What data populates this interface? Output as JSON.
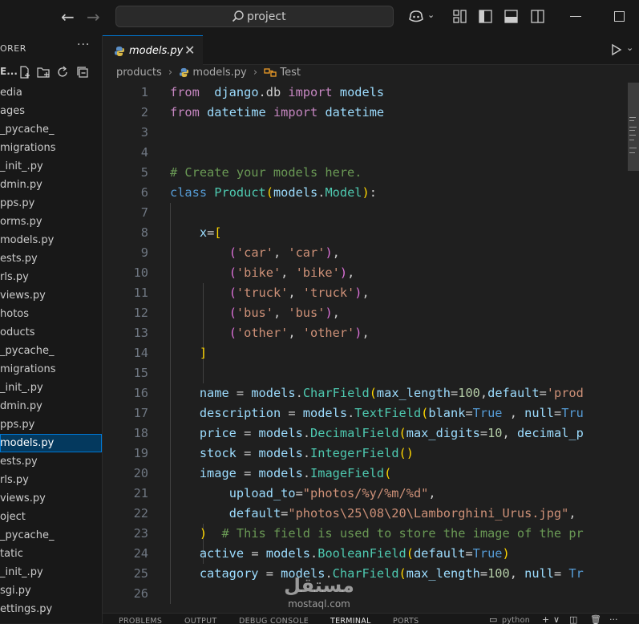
{
  "titlebar": {
    "search_text": "project"
  },
  "sidebar": {
    "title": "ORER",
    "more": "···",
    "project_label": "E...",
    "items": [
      {
        "label": "edia",
        "indent": 0
      },
      {
        "label": "ages",
        "indent": 0
      },
      {
        "label": "_pycache_",
        "indent": 0
      },
      {
        "label": "migrations",
        "indent": 0
      },
      {
        "label": "_init_.py",
        "indent": 0
      },
      {
        "label": "dmin.py",
        "indent": 0
      },
      {
        "label": "pps.py",
        "indent": 0
      },
      {
        "label": "orms.py",
        "indent": 0
      },
      {
        "label": "models.py",
        "indent": 0
      },
      {
        "label": "ests.py",
        "indent": 0
      },
      {
        "label": "rls.py",
        "indent": 0
      },
      {
        "label": "views.py",
        "indent": 0
      },
      {
        "label": "hotos",
        "indent": 0
      },
      {
        "label": "oducts",
        "indent": 0
      },
      {
        "label": "_pycache_",
        "indent": 0
      },
      {
        "label": "migrations",
        "indent": 0
      },
      {
        "label": "_init_.py",
        "indent": 0
      },
      {
        "label": "dmin.py",
        "indent": 0
      },
      {
        "label": "pps.py",
        "indent": 0
      },
      {
        "label": "models.py",
        "indent": 0,
        "active": true
      },
      {
        "label": "ests.py",
        "indent": 0
      },
      {
        "label": "rls.py",
        "indent": 0
      },
      {
        "label": "views.py",
        "indent": 0
      },
      {
        "label": "oject",
        "indent": 0
      },
      {
        "label": "_pycache_",
        "indent": 0
      },
      {
        "label": "tatic",
        "indent": 0
      },
      {
        "label": "_init_.py",
        "indent": 0
      },
      {
        "label": "sgi.py",
        "indent": 0
      },
      {
        "label": "ettings.py",
        "indent": 0
      }
    ]
  },
  "editor": {
    "tab_label": "models.py",
    "tab_close": "✕",
    "breadcrumb": [
      "products",
      "models.py",
      "Test"
    ],
    "lines": [
      {
        "n": "1",
        "tokens": [
          [
            "kw",
            "from"
          ],
          [
            "",
            "  "
          ],
          [
            "va",
            "django"
          ],
          [
            "",
            ".db "
          ],
          [
            "kw",
            "import"
          ],
          [
            "",
            " "
          ],
          [
            "va",
            "models"
          ]
        ]
      },
      {
        "n": "2",
        "tokens": [
          [
            "kw",
            "from"
          ],
          [
            "",
            " "
          ],
          [
            "va",
            "datetime"
          ],
          [
            "",
            " "
          ],
          [
            "kw",
            "import"
          ],
          [
            "",
            " "
          ],
          [
            "va",
            "datetime"
          ]
        ]
      },
      {
        "n": "3",
        "tokens": []
      },
      {
        "n": "4",
        "tokens": []
      },
      {
        "n": "5",
        "tokens": [
          [
            "co",
            "# Create your models here."
          ]
        ]
      },
      {
        "n": "6",
        "tokens": [
          [
            "bk",
            "class"
          ],
          [
            "",
            " "
          ],
          [
            "ty",
            "Product"
          ],
          [
            "b1",
            "("
          ],
          [
            "va",
            "models"
          ],
          [
            "",
            "."
          ],
          [
            "ty",
            "Model"
          ],
          [
            "b1",
            ")"
          ],
          [
            "",
            ":"
          ]
        ]
      },
      {
        "n": "7",
        "tokens": []
      },
      {
        "n": "8",
        "tokens": [
          [
            "",
            "    "
          ],
          [
            "va",
            "x"
          ],
          [
            "",
            "="
          ],
          [
            "b1",
            "["
          ]
        ]
      },
      {
        "n": "9",
        "tokens": [
          [
            "",
            "        "
          ],
          [
            "b2",
            "("
          ],
          [
            "st",
            "'car'"
          ],
          [
            "",
            ", "
          ],
          [
            "st",
            "'car'"
          ],
          [
            "b2",
            ")"
          ],
          [
            "",
            ","
          ]
        ]
      },
      {
        "n": "10",
        "tokens": [
          [
            "",
            "        "
          ],
          [
            "b2",
            "("
          ],
          [
            "st",
            "'bike'"
          ],
          [
            "",
            ", "
          ],
          [
            "st",
            "'bike'"
          ],
          [
            "b2",
            ")"
          ],
          [
            "",
            ","
          ]
        ]
      },
      {
        "n": "11",
        "tokens": [
          [
            "",
            "        "
          ],
          [
            "b2",
            "("
          ],
          [
            "st",
            "'truck'"
          ],
          [
            "",
            ", "
          ],
          [
            "st",
            "'truck'"
          ],
          [
            "b2",
            ")"
          ],
          [
            "",
            ","
          ]
        ]
      },
      {
        "n": "12",
        "tokens": [
          [
            "",
            "        "
          ],
          [
            "b2",
            "("
          ],
          [
            "st",
            "'bus'"
          ],
          [
            "",
            ", "
          ],
          [
            "st",
            "'bus'"
          ],
          [
            "b2",
            ")"
          ],
          [
            "",
            ","
          ]
        ]
      },
      {
        "n": "13",
        "tokens": [
          [
            "",
            "        "
          ],
          [
            "b2",
            "("
          ],
          [
            "st",
            "'other'"
          ],
          [
            "",
            ", "
          ],
          [
            "st",
            "'other'"
          ],
          [
            "b2",
            ")"
          ],
          [
            "",
            ","
          ]
        ]
      },
      {
        "n": "14",
        "tokens": [
          [
            "",
            "    "
          ],
          [
            "b1",
            "]"
          ]
        ]
      },
      {
        "n": "15",
        "tokens": []
      },
      {
        "n": "16",
        "tokens": [
          [
            "",
            "    "
          ],
          [
            "va",
            "name"
          ],
          [
            "",
            " = "
          ],
          [
            "va",
            "models"
          ],
          [
            "",
            "."
          ],
          [
            "ty",
            "CharField"
          ],
          [
            "b1",
            "("
          ],
          [
            "va",
            "max_length"
          ],
          [
            "",
            "="
          ],
          [
            "nu",
            "100"
          ],
          [
            "",
            ","
          ],
          [
            "va",
            "default"
          ],
          [
            "",
            "="
          ],
          [
            "st",
            "'prod"
          ]
        ]
      },
      {
        "n": "17",
        "tokens": [
          [
            "",
            "    "
          ],
          [
            "va",
            "description"
          ],
          [
            "",
            " = "
          ],
          [
            "va",
            "models"
          ],
          [
            "",
            "."
          ],
          [
            "ty",
            "TextField"
          ],
          [
            "b1",
            "("
          ],
          [
            "va",
            "blank"
          ],
          [
            "",
            "="
          ],
          [
            "bk",
            "True"
          ],
          [
            "",
            " , "
          ],
          [
            "va",
            "null"
          ],
          [
            "",
            "="
          ],
          [
            "bk",
            "Tru"
          ]
        ]
      },
      {
        "n": "18",
        "tokens": [
          [
            "",
            "    "
          ],
          [
            "va",
            "price"
          ],
          [
            "",
            " = "
          ],
          [
            "va",
            "models"
          ],
          [
            "",
            "."
          ],
          [
            "ty",
            "DecimalField"
          ],
          [
            "b1",
            "("
          ],
          [
            "va",
            "max_digits"
          ],
          [
            "",
            "="
          ],
          [
            "nu",
            "10"
          ],
          [
            "",
            ", "
          ],
          [
            "va",
            "decimal_p"
          ]
        ]
      },
      {
        "n": "19",
        "tokens": [
          [
            "",
            "    "
          ],
          [
            "va",
            "stock"
          ],
          [
            "",
            " = "
          ],
          [
            "va",
            "models"
          ],
          [
            "",
            "."
          ],
          [
            "ty",
            "IntegerField"
          ],
          [
            "b1",
            "()"
          ]
        ]
      },
      {
        "n": "20",
        "tokens": [
          [
            "",
            "    "
          ],
          [
            "va",
            "image"
          ],
          [
            "",
            " = "
          ],
          [
            "va",
            "models"
          ],
          [
            "",
            "."
          ],
          [
            "ty",
            "ImageField"
          ],
          [
            "b1",
            "("
          ]
        ]
      },
      {
        "n": "21",
        "tokens": [
          [
            "",
            "        "
          ],
          [
            "va",
            "upload_to"
          ],
          [
            "",
            "="
          ],
          [
            "st",
            "\"photos/%y/%m/%d\""
          ],
          [
            "",
            ","
          ]
        ]
      },
      {
        "n": "22",
        "tokens": [
          [
            "",
            "        "
          ],
          [
            "va",
            "default"
          ],
          [
            "",
            "="
          ],
          [
            "st",
            "\"photos\\25\\08\\20\\Lamborghini_Urus.jpg\""
          ],
          [
            "",
            ", "
          ]
        ]
      },
      {
        "n": "23",
        "tokens": [
          [
            "",
            "    "
          ],
          [
            "b1",
            ")"
          ],
          [
            "",
            "  "
          ],
          [
            "co",
            "# This field is used to store the image of the pr"
          ]
        ]
      },
      {
        "n": "24",
        "tokens": [
          [
            "",
            "    "
          ],
          [
            "va",
            "active"
          ],
          [
            "",
            " = "
          ],
          [
            "va",
            "models"
          ],
          [
            "",
            "."
          ],
          [
            "ty",
            "BooleanField"
          ],
          [
            "b1",
            "("
          ],
          [
            "va",
            "default"
          ],
          [
            "",
            "="
          ],
          [
            "bk",
            "True"
          ],
          [
            "b1",
            ")"
          ]
        ]
      },
      {
        "n": "25",
        "tokens": [
          [
            "",
            "    "
          ],
          [
            "va",
            "catagory"
          ],
          [
            "",
            " = "
          ],
          [
            "va",
            "models"
          ],
          [
            "",
            "."
          ],
          [
            "ty",
            "CharField"
          ],
          [
            "b1",
            "("
          ],
          [
            "va",
            "max_length"
          ],
          [
            "",
            "="
          ],
          [
            "nu",
            "100"
          ],
          [
            "",
            ", "
          ],
          [
            "va",
            "null"
          ],
          [
            "",
            "= "
          ],
          [
            "bk",
            "Tr"
          ]
        ]
      },
      {
        "n": "26",
        "tokens": []
      }
    ]
  },
  "panel": {
    "tabs": [
      "PROBLEMS",
      "OUTPUT",
      "DEBUG CONSOLE",
      "TERMINAL",
      "PORTS"
    ],
    "active_tab": "TERMINAL",
    "terminal_label": "python",
    "add": "+",
    "chevron": "∨",
    "trash": "🗑",
    "more": "···"
  },
  "watermark": {
    "text": "مستقل",
    "sub": "mostaql.com"
  }
}
